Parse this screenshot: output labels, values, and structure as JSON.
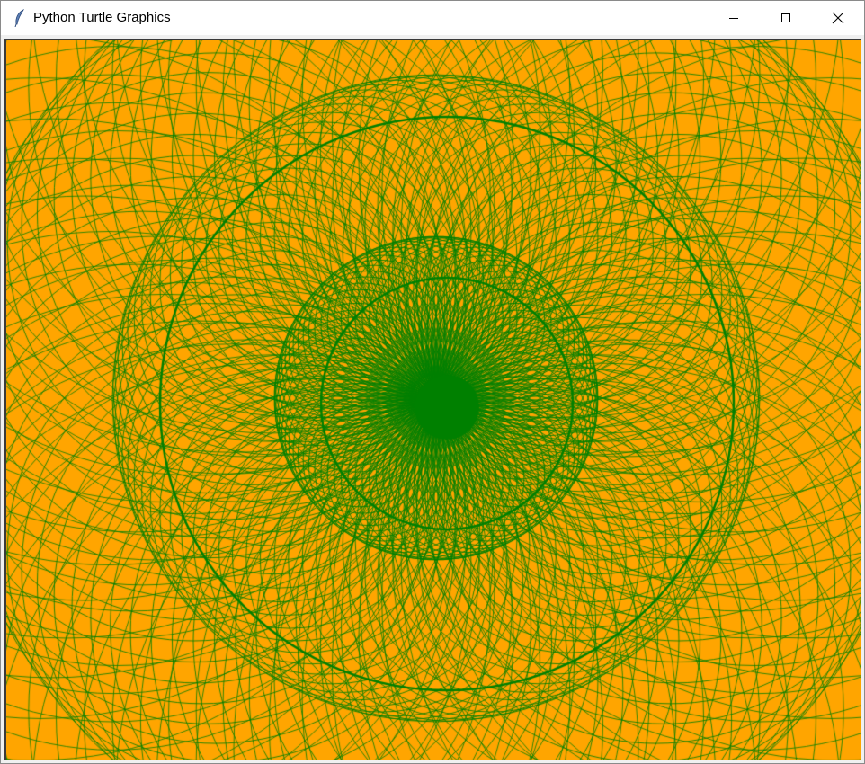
{
  "window": {
    "title": "Python Turtle Graphics",
    "app_icon": "feather-icon",
    "controls": {
      "minimize_icon": "minimize-icon",
      "maximize_icon": "maximize-icon",
      "close_icon": "close-icon"
    }
  },
  "canvas": {
    "background_color": "#FFA500",
    "pen_color": "#008000"
  }
}
